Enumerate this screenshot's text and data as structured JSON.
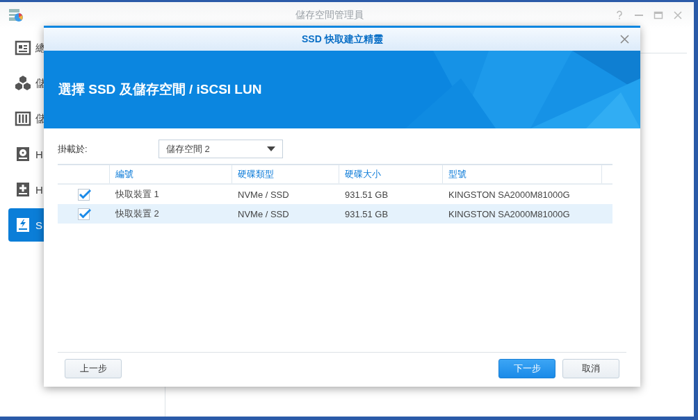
{
  "app": {
    "title": "儲存空間管理員"
  },
  "sidebar": {
    "items": [
      {
        "kind": "overview",
        "label": "總",
        "selected": false
      },
      {
        "kind": "pool",
        "label": "儲",
        "selected": false
      },
      {
        "kind": "volume",
        "label": "儲",
        "selected": false
      },
      {
        "kind": "hdd",
        "label": "H",
        "selected": false
      },
      {
        "kind": "hotspare",
        "label": "H",
        "selected": false
      },
      {
        "kind": "ssd",
        "label": "S",
        "selected": true
      }
    ]
  },
  "dialog": {
    "title": "SSD 快取建立精靈",
    "heading": "選擇 SSD 及儲存空間 / iSCSI LUN",
    "mount": {
      "label": "掛載於:",
      "value": "儲存空間 2"
    },
    "table": {
      "columns": [
        "編號",
        "硬碟類型",
        "硬碟大小",
        "型號"
      ],
      "rows": [
        {
          "checked": true,
          "selected": false,
          "cells": [
            "快取裝置 1",
            "NVMe / SSD",
            "931.51 GB",
            "KINGSTON SA2000M81000G"
          ]
        },
        {
          "checked": true,
          "selected": true,
          "cells": [
            "快取裝置 2",
            "NVMe / SSD",
            "931.51 GB",
            "KINGSTON SA2000M81000G"
          ]
        }
      ]
    },
    "buttons": [
      {
        "label": "上一步",
        "kind": "secondary"
      },
      {
        "label": "下一步",
        "kind": "primary"
      },
      {
        "label": "取消",
        "kind": "secondary"
      }
    ]
  }
}
